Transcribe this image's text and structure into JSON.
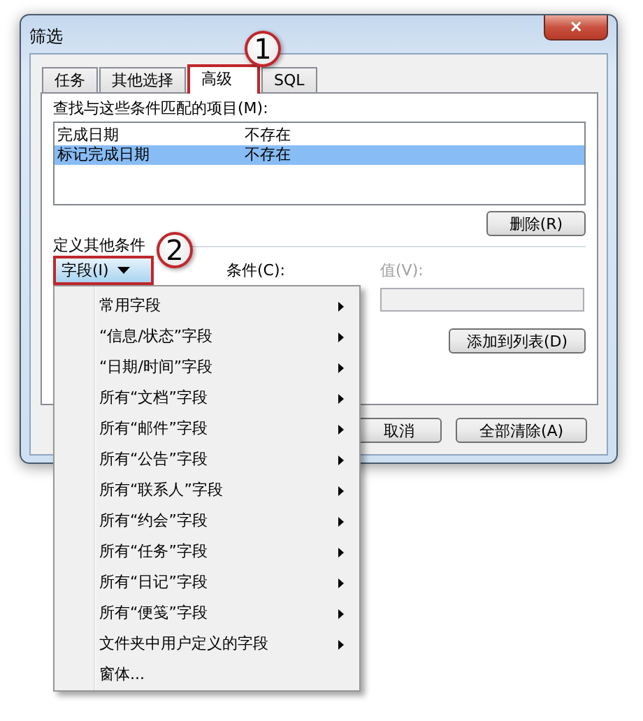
{
  "window": {
    "title": "筛选",
    "close": "✕"
  },
  "tabs": [
    {
      "label": "任务",
      "selected": false
    },
    {
      "label": "其他选择",
      "selected": false
    },
    {
      "label": "高级",
      "selected": true
    },
    {
      "label": "SQL",
      "selected": false
    }
  ],
  "match_list": {
    "label": "查找与这些条件匹配的项目(M):",
    "rows": [
      {
        "field": "完成日期",
        "condition": "不存在",
        "selected": false
      },
      {
        "field": "标记完成日期",
        "condition": "不存在",
        "selected": true
      }
    ]
  },
  "delete_button": "删除(R)",
  "define_section": {
    "label": "定义其他条件",
    "field_button": "字段(I)",
    "condition_label": "条件(C):",
    "value_label": "值(V):",
    "value_disabled": true,
    "add_button": "添加到列表(D)"
  },
  "bottom_buttons": [
    "取消",
    "全部清除(A)"
  ],
  "field_menu": [
    {
      "label": "常用字段",
      "submenu": true
    },
    {
      "label": "“信息/状态”字段",
      "submenu": true
    },
    {
      "label": "“日期/时间”字段",
      "submenu": true
    },
    {
      "label": "所有“文档”字段",
      "submenu": true
    },
    {
      "label": "所有“邮件”字段",
      "submenu": true
    },
    {
      "label": "所有“公告”字段",
      "submenu": true
    },
    {
      "label": "所有“联系人”字段",
      "submenu": true
    },
    {
      "label": "所有“约会”字段",
      "submenu": true
    },
    {
      "label": "所有“任务”字段",
      "submenu": true
    },
    {
      "label": "所有“日记”字段",
      "submenu": true
    },
    {
      "label": "所有“便笺”字段",
      "submenu": true
    },
    {
      "label": "文件夹中用户定义的字段",
      "submenu": true
    },
    {
      "label": "窗体...",
      "submenu": false
    }
  ],
  "callouts": [
    {
      "number": "1"
    },
    {
      "number": "2"
    }
  ]
}
